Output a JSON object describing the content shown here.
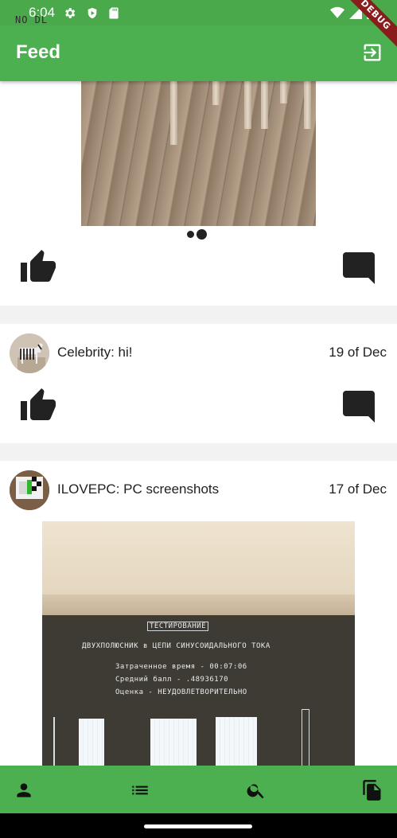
{
  "status_bar": {
    "time": "6:04",
    "overlay_text": "NO DL",
    "left_icons": [
      "gear-icon",
      "shield-play-icon",
      "sd-card-icon"
    ],
    "right_icons": [
      "wifi-icon",
      "signal-icon",
      "battery-icon"
    ]
  },
  "app_bar": {
    "title": "Feed",
    "action_icon": "logout-icon",
    "debug_banner": "DEBUG"
  },
  "posts": [
    {
      "image_icon": "photo-floor-chairs",
      "carousel_dots": 2,
      "actions": [
        "thumb-up-icon",
        "comment-icon"
      ]
    },
    {
      "author": "Celebrity",
      "text": "Celebrity: hi!",
      "date": "19 of Dec",
      "avatar_icon": "zebra-avatar-icon",
      "actions": [
        "thumb-up-icon",
        "comment-icon"
      ]
    },
    {
      "author": "ILOVEPC",
      "text": "ILOVEPC: PC screenshots",
      "date": "17 of Dec",
      "avatar_icon": "pc-avatar-icon",
      "image_icon": "photo-pc-screen",
      "screen_lines": [
        "ТЕСТИРОВАНИЕ",
        "ДВУХПОЛЮСНИК в ЦЕПИ СИНУСОИДАЛЬНОГО ТОКА",
        "Затраченное время - 00:07:06",
        "Средний балл -  .48936170",
        "Оценка - НЕУДОВЛЕТВОРИТЕЛЬНО"
      ]
    }
  ],
  "bottom_nav": {
    "items": [
      "person-icon",
      "list-icon",
      "search-icon",
      "copy-icon"
    ]
  },
  "colors": {
    "primary": "#4caf50",
    "status_bar": "#49a94b",
    "icon": "#222222",
    "debug": "#8b1c1c"
  }
}
